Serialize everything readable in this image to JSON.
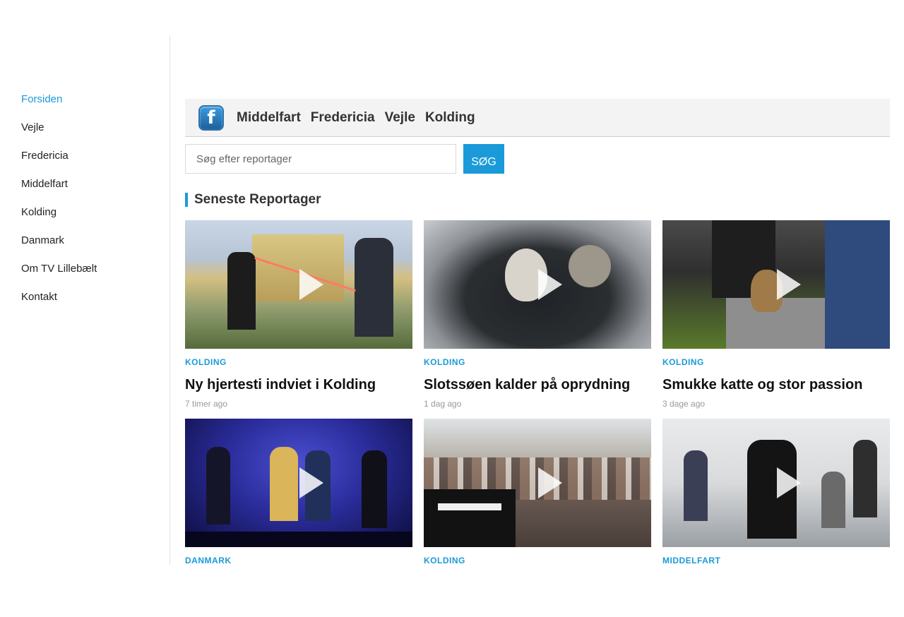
{
  "sidebar": {
    "items": [
      {
        "label": "Forsiden"
      },
      {
        "label": "Vejle"
      },
      {
        "label": "Fredericia"
      },
      {
        "label": "Middelfart"
      },
      {
        "label": "Kolding"
      },
      {
        "label": "Danmark"
      },
      {
        "label": "Om TV Lillebælt"
      },
      {
        "label": "Kontakt"
      }
    ],
    "active_index": 0
  },
  "topnav": {
    "facebook_icon_glyph": "f",
    "links": [
      "Middelfart",
      "Fredericia",
      "Vejle",
      "Kolding"
    ]
  },
  "search": {
    "placeholder": "Søg efter reportager",
    "button_label": "SØG"
  },
  "section": {
    "title": "Seneste Reportager"
  },
  "articles": [
    {
      "category": "KOLDING",
      "title": "Ny hjertesti indviet i Kolding",
      "time": "7 timer ago"
    },
    {
      "category": "KOLDING",
      "title": "Slotssøen kalder på oprydning",
      "time": "1 dag ago"
    },
    {
      "category": "KOLDING",
      "title": "Smukke katte og stor passion",
      "time": "3 dage ago"
    },
    {
      "category": "DANMARK",
      "title": "",
      "time": ""
    },
    {
      "category": "KOLDING",
      "title": "",
      "time": ""
    },
    {
      "category": "MIDDELFART",
      "title": "",
      "time": ""
    }
  ],
  "colors": {
    "accent": "#1a9ad9",
    "nav_bg": "#f3f3f3"
  }
}
